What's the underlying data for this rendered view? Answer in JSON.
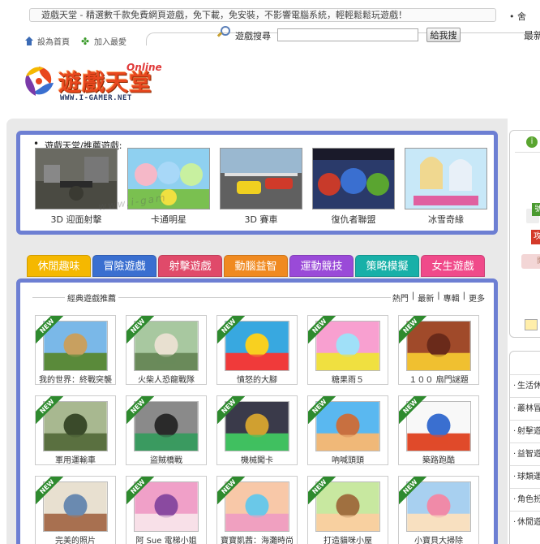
{
  "header": {
    "marquee": "遊戲天堂 - 精選數千款免費網頁遊戲，免下載，免安裝，不影響電腦系統，輕輕鬆鬆玩遊戲！",
    "marquee_extra": "• 舍",
    "set_home": "設為首頁",
    "add_fav": "加入最愛",
    "search_label": "遊戲搜尋",
    "search_value": "",
    "search_button": "給我搜",
    "right_text": "最新"
  },
  "logo": {
    "main": "遊戲天堂",
    "online": "Online",
    "url": "WWW.I-GAMER.NET"
  },
  "recommended": {
    "title": "遊戲天堂/推薦遊戲:",
    "watermark": "www.i-gam",
    "items": [
      {
        "label": "3D 迎面射擊"
      },
      {
        "label": "卡通明星"
      },
      {
        "label": "3D 賽車"
      },
      {
        "label": "復仇者聯盟"
      },
      {
        "label": "冰雪奇緣"
      }
    ]
  },
  "tabs": [
    {
      "label": "休閒趣味",
      "color": "#f5b800"
    },
    {
      "label": "冒險遊戲",
      "color": "#3a6fd0"
    },
    {
      "label": "射擊遊戲",
      "color": "#e04a6a"
    },
    {
      "label": "動腦益智",
      "color": "#f08a20"
    },
    {
      "label": "運動競技",
      "color": "#9a4ad8"
    },
    {
      "label": "策略模擬",
      "color": "#18b0a8"
    },
    {
      "label": "女生遊戲",
      "color": "#f04a8a"
    }
  ],
  "games": {
    "title": "經典遊戲推薦",
    "links": [
      "熱門",
      "|",
      "最新",
      "|",
      "專輯",
      "|",
      "更多"
    ],
    "badge": "NEW",
    "items": [
      {
        "label": "我的世界：終戰突襲"
      },
      {
        "label": "火柴人恐龍戰隊"
      },
      {
        "label": "憤怒的大腳"
      },
      {
        "label": "糖果雨５"
      },
      {
        "label": "１００ 扇門謎題"
      },
      {
        "label": "軍用運輸車"
      },
      {
        "label": "盜賊橋戰"
      },
      {
        "label": "機械闖卡"
      },
      {
        "label": "吶喊頭頭"
      },
      {
        "label": "築路跑酷"
      },
      {
        "label": "完美的照片"
      },
      {
        "label": "阿 Sue 電梯小姐"
      },
      {
        "label": "寶寶凱茜：海灘時尚"
      },
      {
        "label": "打造貓咪小屋"
      },
      {
        "label": "小寶貝大掃除"
      }
    ]
  },
  "sidebar": {
    "top_icon": "i",
    "tag_green": "號",
    "tag_red": "攻",
    "tag_pink": "閱",
    "items": [
      "生活休",
      "叢林冒",
      "射擊遊",
      "益智遊",
      "球類運",
      "角色扮",
      "休閒遊"
    ]
  }
}
